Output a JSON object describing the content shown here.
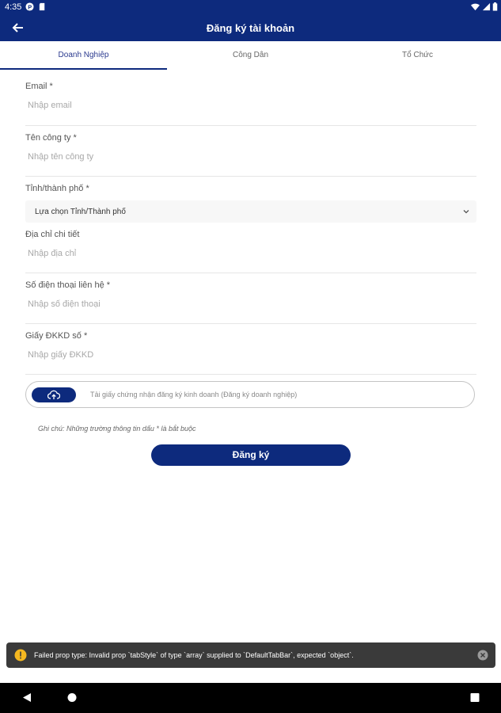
{
  "status_bar": {
    "time": "4:35"
  },
  "app_bar": {
    "title": "Đăng ký tài khoản"
  },
  "tabs": [
    {
      "label": "Doanh Nghiệp",
      "active": true
    },
    {
      "label": "Công Dân",
      "active": false
    },
    {
      "label": "Tổ Chức",
      "active": false
    }
  ],
  "form": {
    "email": {
      "label": "Email *",
      "placeholder": "Nhập email",
      "value": ""
    },
    "company": {
      "label": "Tên công ty *",
      "placeholder": "Nhập tên công ty",
      "value": ""
    },
    "province": {
      "label": "Tỉnh/thành phố *",
      "selected": "Lựa chọn Tỉnh/Thành phố"
    },
    "address": {
      "label": "Địa chỉ chi tiết",
      "placeholder": "Nhập địa chỉ",
      "value": ""
    },
    "phone": {
      "label": "Số điện thoại liên hệ *",
      "placeholder": "Nhập số điện thoại",
      "value": ""
    },
    "license": {
      "label": "Giấy ĐKKD số *",
      "placeholder": "Nhập giấy ĐKKD",
      "value": ""
    },
    "upload_text": "Tải giấy chứng nhận đăng ký kinh doanh (Đăng ký doanh nghiệp)",
    "note": "Ghi chú: Những trường thông tin dấu * là bắt buộc",
    "submit_label": "Đăng ký"
  },
  "toast": {
    "message": "Failed prop type: Invalid prop `tabStyle` of type `array` supplied to `DefaultTabBar`, expected `object`."
  },
  "colors": {
    "primary": "#0d2a7d",
    "toast_bg": "#3a3a3a",
    "warning": "#f5b820"
  }
}
